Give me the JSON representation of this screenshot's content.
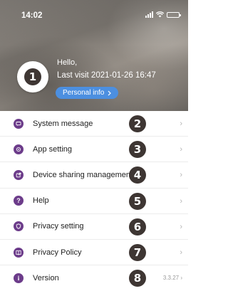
{
  "status_bar": {
    "time": "14:02"
  },
  "profile": {
    "greeting": "Hello,",
    "last_visit": "Last visit 2021-01-26 16:47",
    "personal_info_label": "Personal info",
    "avatar_marker": "1"
  },
  "menu": {
    "items": [
      {
        "label": "System message",
        "icon": "message-icon",
        "marker": "2"
      },
      {
        "label": "App setting",
        "icon": "settings-icon",
        "marker": "3"
      },
      {
        "label": "Device sharing management",
        "icon": "share-icon",
        "marker": "4"
      },
      {
        "label": "Help",
        "icon": "help-icon",
        "marker": "5"
      },
      {
        "label": "Privacy setting",
        "icon": "shield-icon",
        "marker": "6"
      },
      {
        "label": "Privacy Policy",
        "icon": "book-icon",
        "marker": "7"
      },
      {
        "label": "Version",
        "icon": "info-icon",
        "marker": "8",
        "value": "3.3.27"
      }
    ]
  },
  "colors": {
    "accent": "#6c3c8a",
    "button_blue": "#4c8fe0",
    "marker": "#3e3633"
  }
}
